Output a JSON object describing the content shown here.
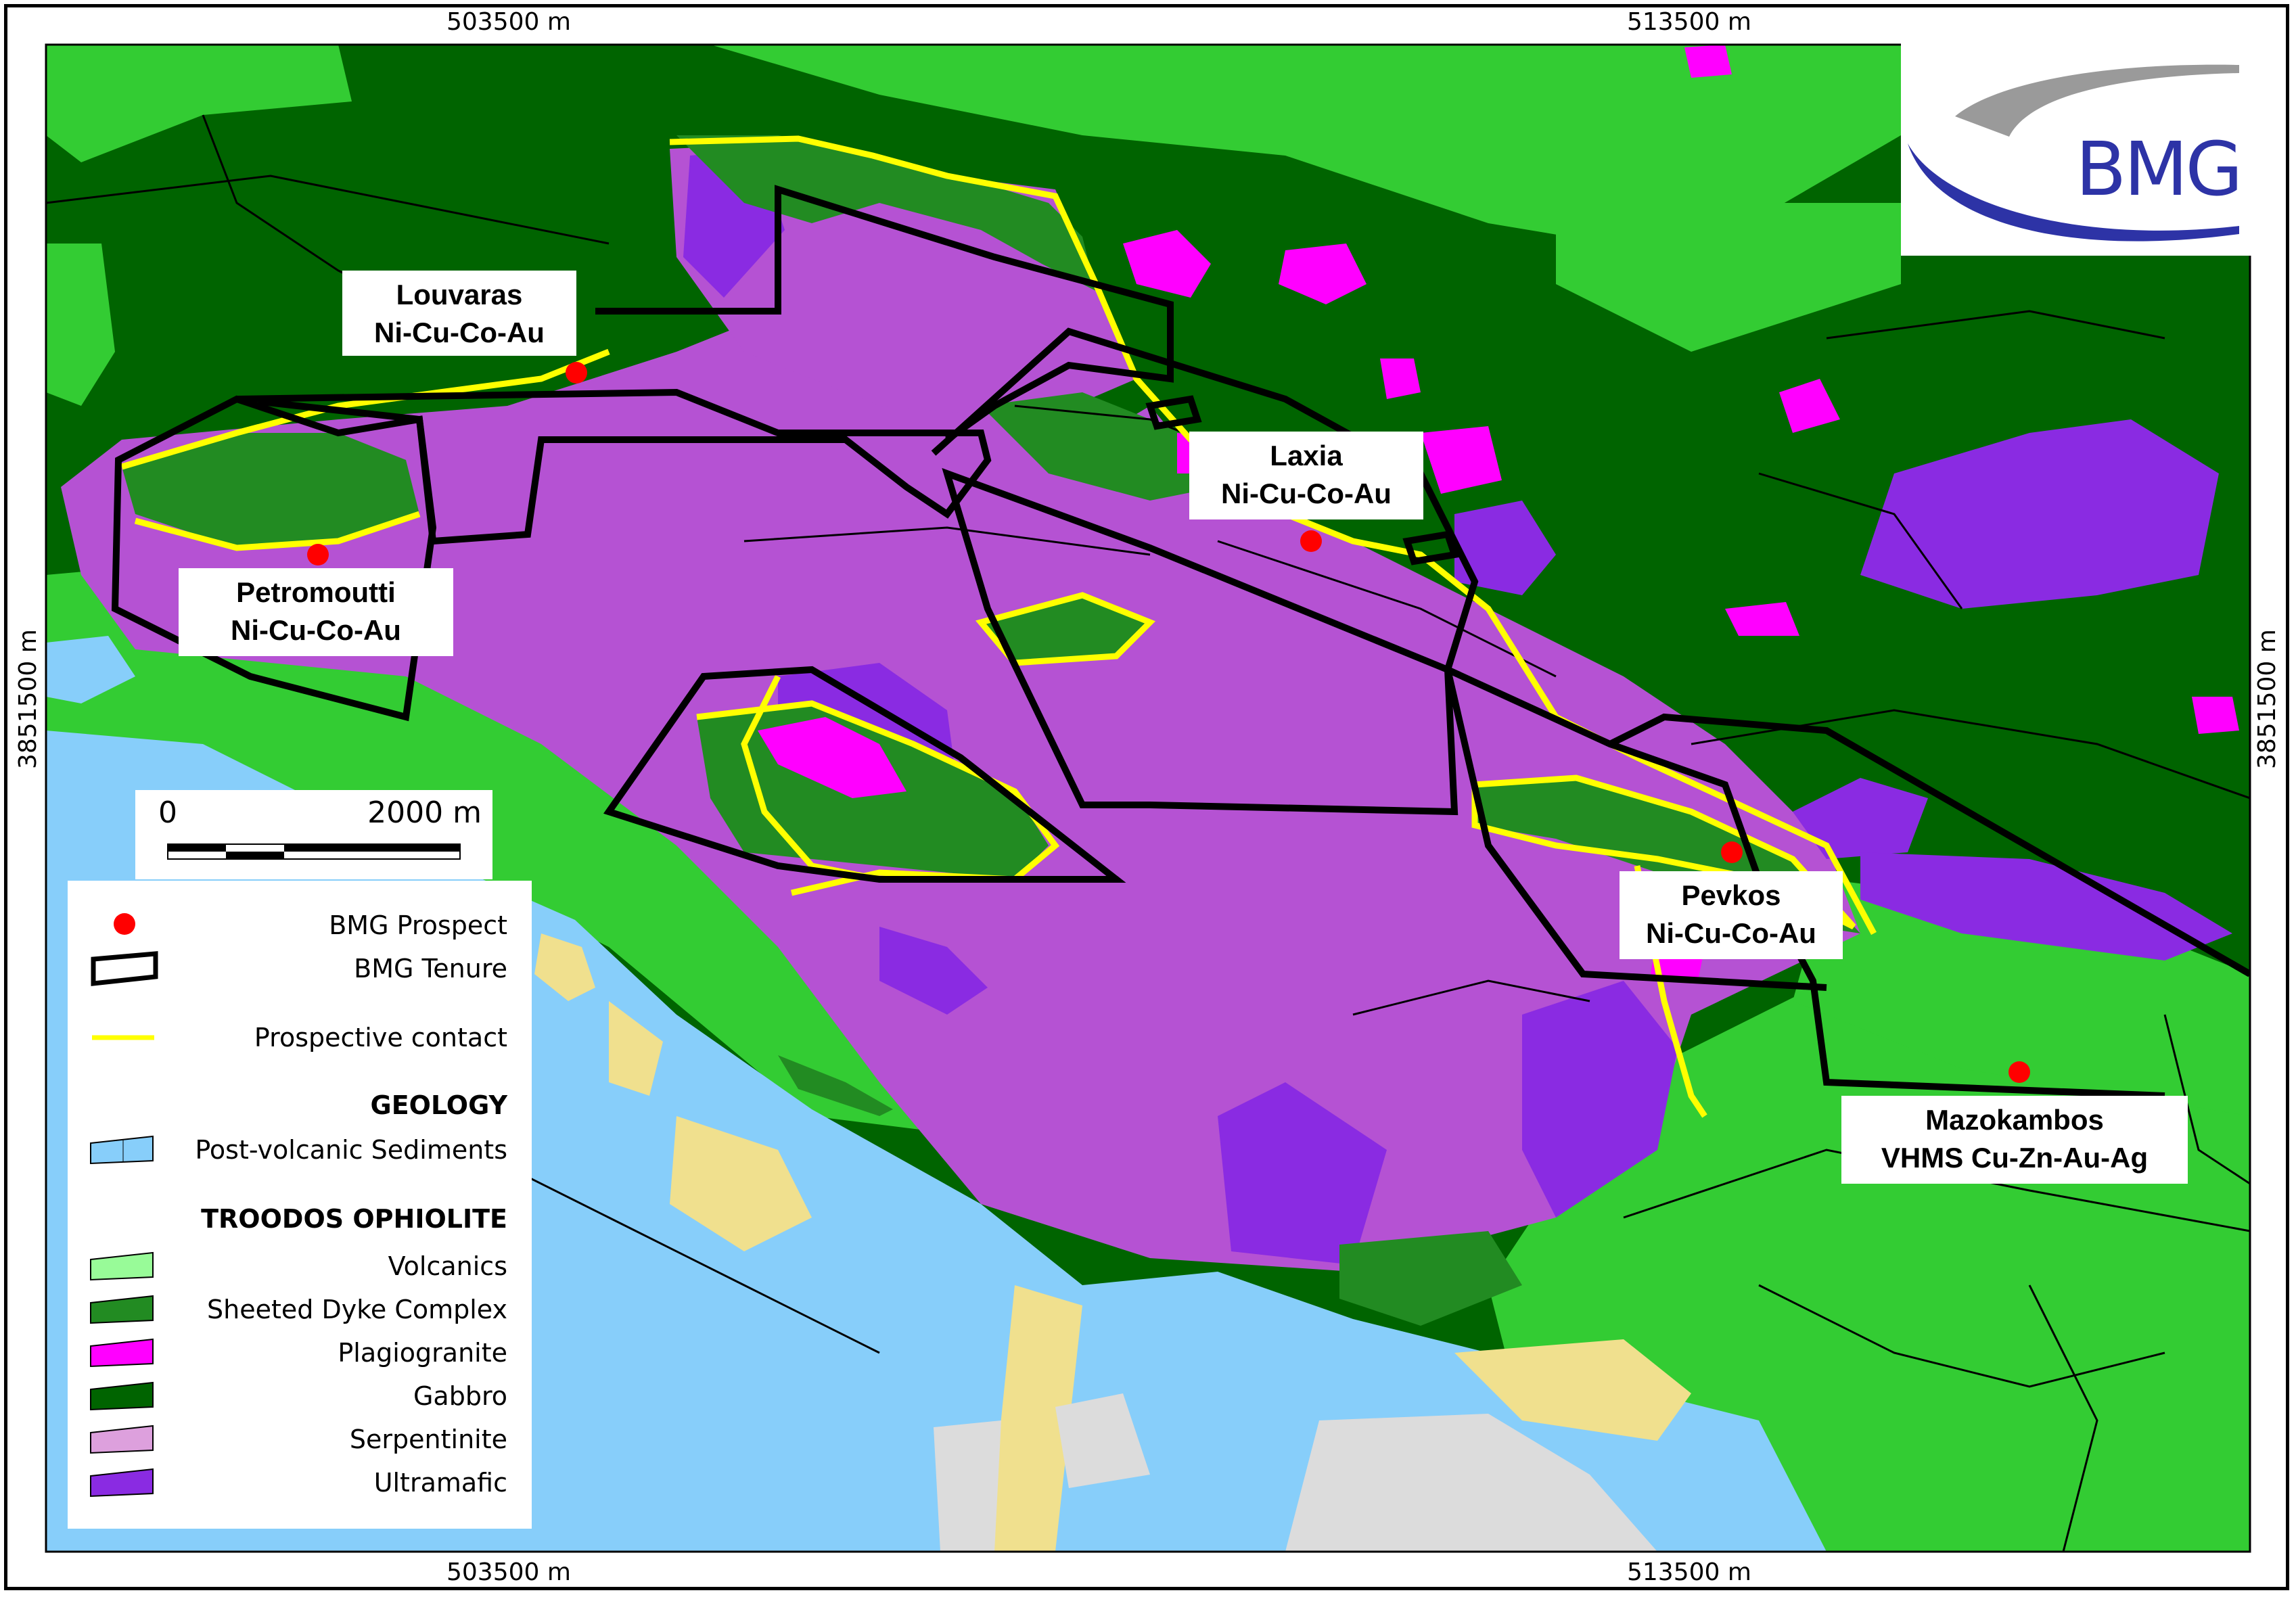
{
  "coordinates": {
    "top_left": "503500 m",
    "top_right": "513500 m",
    "bottom_left": "503500 m",
    "bottom_right": "513500 m",
    "left": "3851500 m",
    "right": "3851500 m"
  },
  "logo": {
    "text": "BMG"
  },
  "prospects": [
    {
      "name": "Louvaras",
      "commodity": "Ni-Cu-Co-Au"
    },
    {
      "name": "Petromoutti",
      "commodity": "Ni-Cu-Co-Au"
    },
    {
      "name": "Laxia",
      "commodity": "Ni-Cu-Co-Au"
    },
    {
      "name": "Pevkos",
      "commodity": "Ni-Cu-Co-Au"
    },
    {
      "name": "Mazokambos",
      "commodity": "VHMS Cu-Zn-Au-Ag"
    }
  ],
  "scalebar": {
    "zero": "0",
    "max": "2000 m"
  },
  "legend": {
    "prospect": "BMG Prospect",
    "tenure": "BMG Tenure",
    "contact": "Prospective contact",
    "geology_heading": "GEOLOGY",
    "sediments": "Post-volcanic Sediments",
    "troodos_heading": "TROODOS OPHIOLITE",
    "volcanics": "Volcanics",
    "dyke": "Sheeted Dyke Complex",
    "plagiogranite": "Plagiogranite",
    "gabbro": "Gabbro",
    "serpentinite": "Serpentinite",
    "ultramafic": "Ultramafic"
  },
  "colors": {
    "sediments": "#87cefa",
    "alluvium": "#f0e08e",
    "grey_unit": "#dcdcdc",
    "volcanics": "#33cc33",
    "volcanics_light": "#98fb98",
    "dyke": "#228b22",
    "gabbro": "#006400",
    "plagiogranite": "#ff00ff",
    "serpentinite": "#b552d3",
    "serpentinite_legend": "#dda0dd",
    "ultramafic": "#8a2be2",
    "prospect_dot": "#ff0000",
    "contact_line": "#ffff00",
    "tenure_line": "#000000",
    "logo_blue": "#2d33a6",
    "logo_grey": "#9a9a9a"
  }
}
